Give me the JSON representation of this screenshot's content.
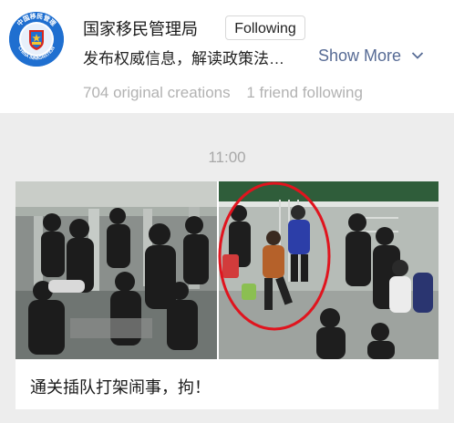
{
  "account": {
    "name": "国家移民管理局",
    "follow_label": "Following",
    "description": "发布权威信息，解读政策法…",
    "show_more_label": "Show More",
    "logo": {
      "arc_text": "中国移民管理",
      "bottom_text": "CHINA IMMIGRATION"
    }
  },
  "stats": {
    "original": "704 original creations",
    "friends": "1 friend following"
  },
  "feed": {
    "timestamp": "11:00",
    "article": {
      "title": "通关插队打架闹事，拘！"
    }
  },
  "colors": {
    "link": "#576b95",
    "logo_blue": "#1f6fd0",
    "highlight_circle": "#e0141e",
    "background": "#ededed"
  }
}
